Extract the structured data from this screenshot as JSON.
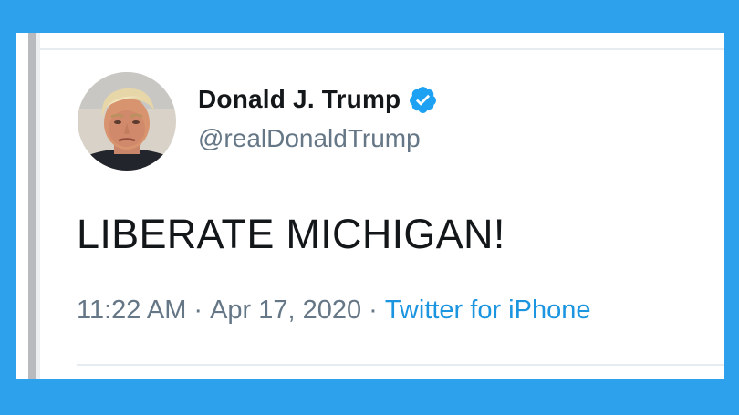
{
  "tweet": {
    "author": {
      "display_name": "Donald J. Trump",
      "handle": "@realDonaldTrump",
      "verified": true
    },
    "text": "LIBERATE MICHIGAN!",
    "time": "11:22 AM",
    "separator": "·",
    "date": "Apr 17, 2020",
    "source": "Twitter for iPhone"
  },
  "icons": {
    "avatar": "profile-photo",
    "verified": "verified-badge-icon"
  },
  "colors": {
    "background": "#2ea1ec",
    "card": "#ffffff",
    "name_text": "#14171a",
    "secondary_text": "#657786",
    "link": "#1b95e0",
    "verified_badge": "#1da1f2"
  }
}
